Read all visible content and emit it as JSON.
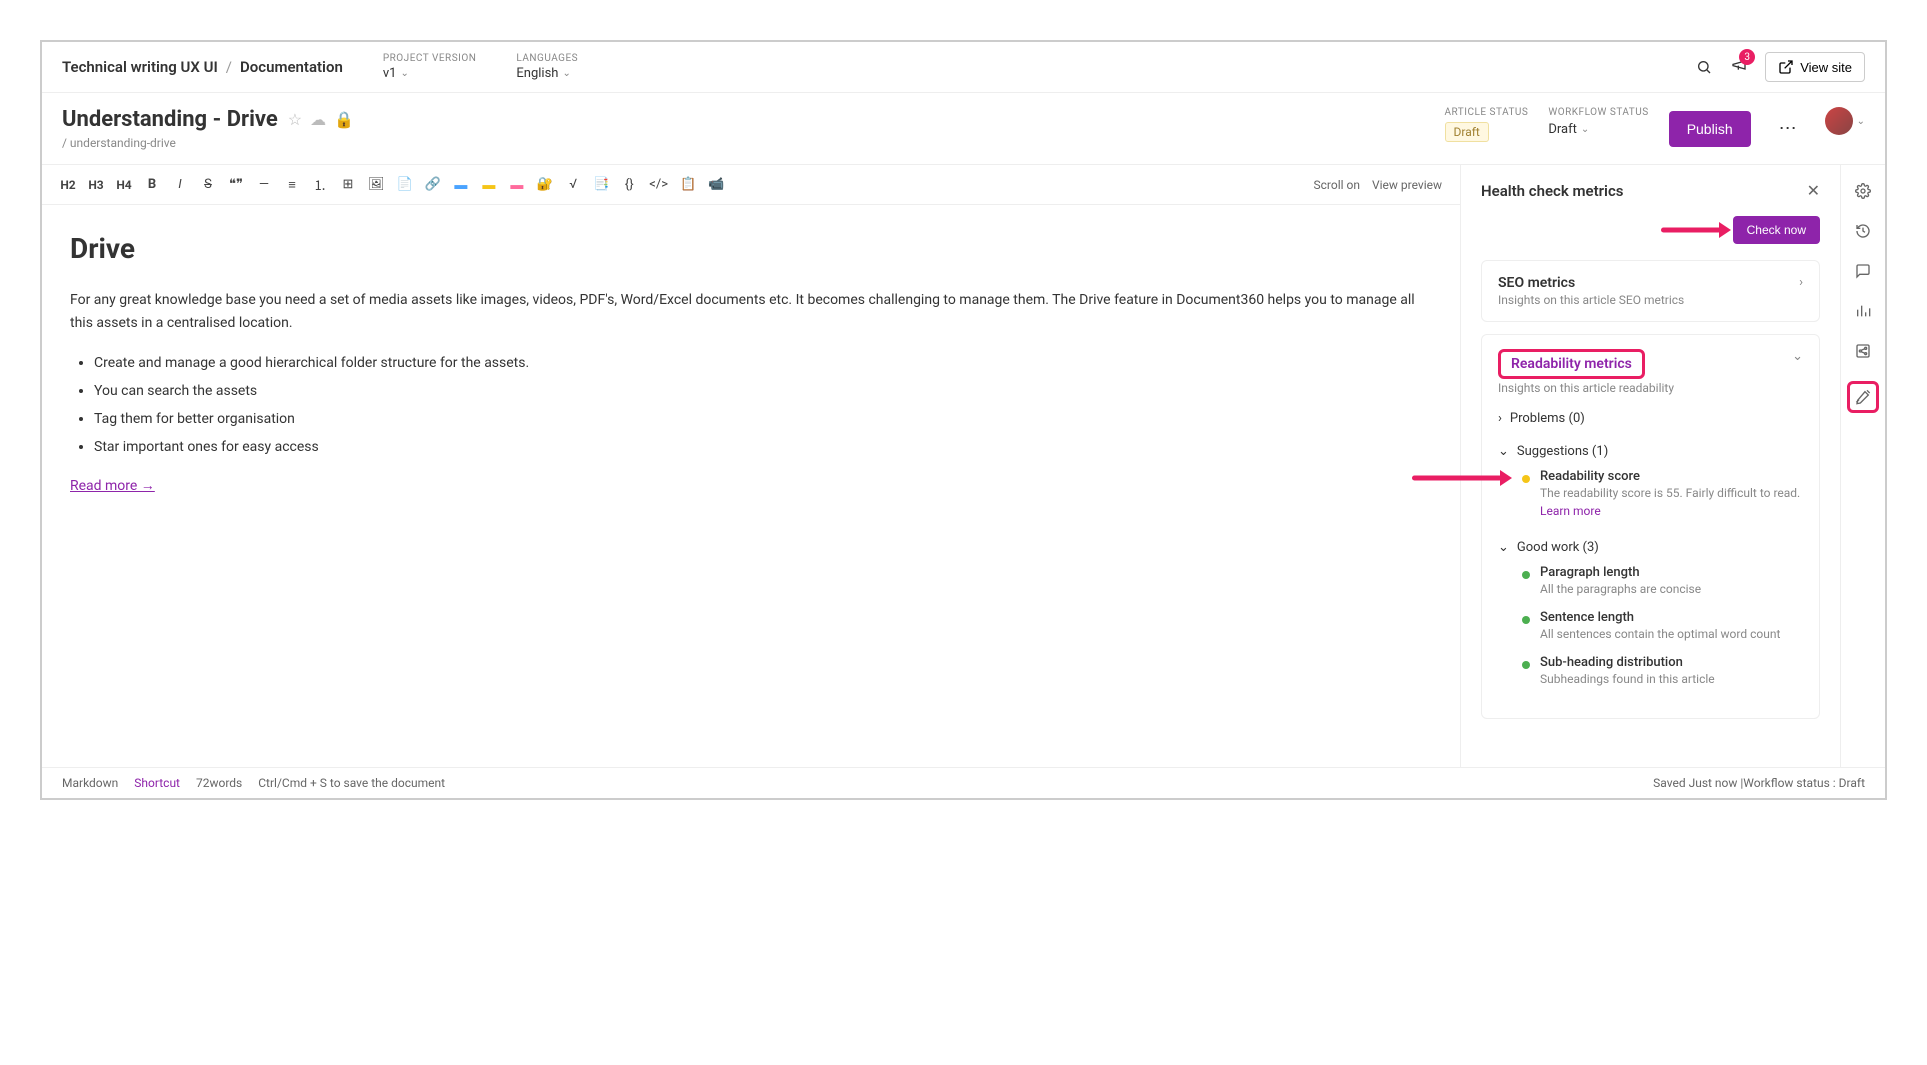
{
  "breadcrumb": {
    "project": "Technical writing UX UI",
    "section": "Documentation"
  },
  "header_meta": {
    "version_label": "PROJECT VERSION",
    "version_value": "v1",
    "lang_label": "LANGUAGES",
    "lang_value": "English"
  },
  "notifications_count": "3",
  "view_site_label": "View site",
  "article": {
    "title": "Understanding - Drive",
    "slug": "/ understanding-drive",
    "status_label": "ARTICLE STATUS",
    "status_value": "Draft",
    "workflow_label": "WORKFLOW STATUS",
    "workflow_value": "Draft",
    "publish_label": "Publish"
  },
  "toolbar": {
    "scroll": "Scroll on",
    "preview": "View preview"
  },
  "content": {
    "heading": "Drive",
    "para": "For any great knowledge base you need a set of media assets like images, videos, PDF's, Word/Excel documents etc. It becomes challenging to manage them. The Drive feature in Document360 helps you to manage all this assets in a centralised location.",
    "bullets": [
      "Create and manage a good hierarchical folder structure for the assets.",
      "You can search the assets",
      "Tag them for better organisation",
      "Star important ones for easy access"
    ],
    "read_more": "Read more →"
  },
  "panel": {
    "title": "Health check metrics",
    "check_now": "Check now",
    "seo": {
      "title": "SEO metrics",
      "sub": "Insights on this article SEO metrics"
    },
    "readability": {
      "title": "Readability metrics",
      "sub": "Insights on this article readability",
      "problems_label": "Problems (0)",
      "suggestions_label": "Suggestions (1)",
      "good_label": "Good work (3)",
      "suggestion": {
        "title": "Readability score",
        "desc": "The readability score is 55. Fairly difficult to read. ",
        "learn": "Learn more"
      },
      "good": [
        {
          "title": "Paragraph length",
          "desc": "All the paragraphs are concise"
        },
        {
          "title": "Sentence length",
          "desc": "All sentences contain the optimal word count"
        },
        {
          "title": "Sub-heading distribution",
          "desc": "Subheadings found in this article"
        }
      ]
    }
  },
  "footer": {
    "mode": "Markdown",
    "shortcut": "Shortcut",
    "words": "72words",
    "save_hint": "Ctrl/Cmd + S to save the document",
    "saved": "Saved Just now |Workflow status : Draft"
  }
}
